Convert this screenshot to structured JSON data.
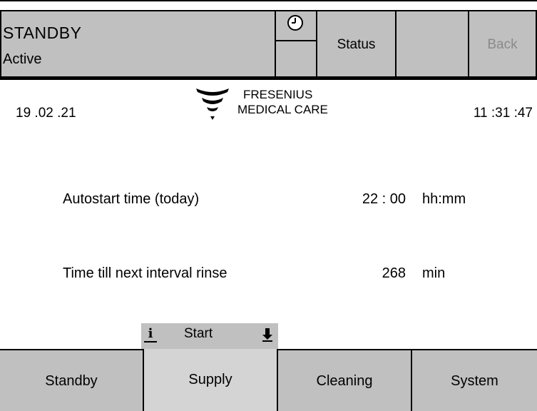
{
  "header": {
    "mode": "STANDBY",
    "sub_state": "Active",
    "clock_icon": "clock-icon",
    "status_label": "Status",
    "back_label": "Back"
  },
  "info": {
    "date": "19 .02 .21",
    "time": "11 :31 :47",
    "logo_line1": "FRESENIUS",
    "logo_line2": "MEDICAL CARE"
  },
  "params": [
    {
      "label": "Autostart time (today)",
      "value": "22 : 00",
      "unit": "hh:mm"
    },
    {
      "label": "Time till next interval rinse",
      "value": "268",
      "unit": "min"
    }
  ],
  "start_bar": {
    "info_icon_glyph": "i",
    "label": "Start",
    "icons": [
      "info-icon",
      "arrow-down-icon"
    ]
  },
  "tabs": [
    {
      "label": "Standby"
    },
    {
      "label": "Supply",
      "selected": true
    },
    {
      "label": "Cleaning"
    },
    {
      "label": "System"
    }
  ],
  "colors": {
    "panel_gray": "#c0c0c0",
    "selected_tab": "#d4d4d4",
    "disabled_text": "#8a8a8a",
    "background": "#ffffff"
  }
}
